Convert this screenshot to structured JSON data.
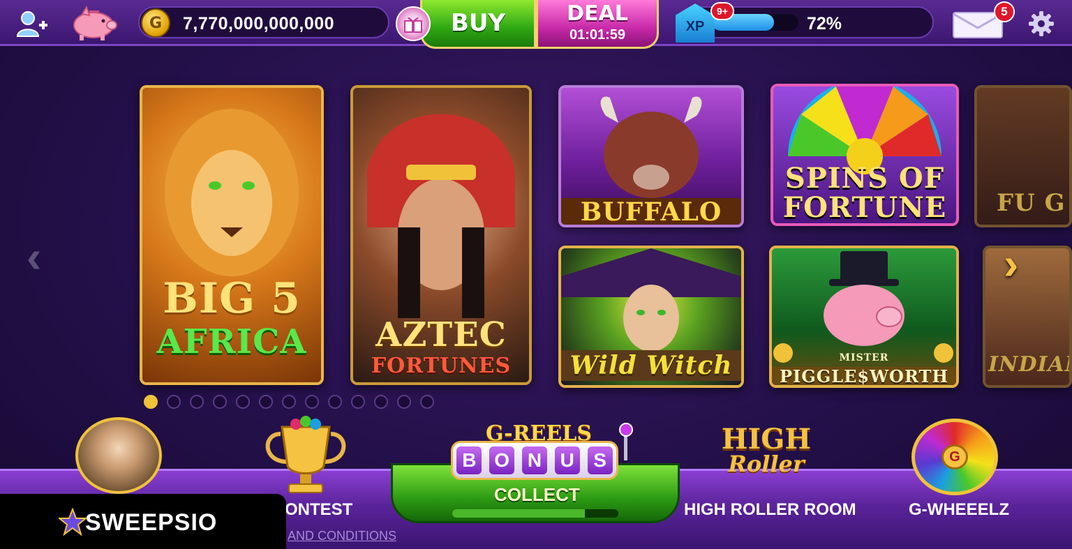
{
  "topbar": {
    "coins": "7,770,000,000,000",
    "coin_symbol": "G",
    "buy_label": "BUY",
    "deal_label": "DEAL",
    "deal_timer": "01:01:59",
    "xp_label": "XP",
    "xp_level_badge": "9+",
    "xp_percent_text": "72%",
    "xp_progress": 0.72,
    "mail_count": "5"
  },
  "carousel": {
    "games": [
      {
        "id": "big5",
        "line1": "BIG 5",
        "line2": "AFRICA"
      },
      {
        "id": "aztec",
        "line1": "AZTEC",
        "line2": "FORTUNES"
      },
      {
        "id": "buffalo",
        "line1": "BUFFALO"
      },
      {
        "id": "spins",
        "line1": "SPINS OF",
        "line2": "FORTUNE"
      },
      {
        "id": "fu",
        "line1": "FU G"
      },
      {
        "id": "witch",
        "line1": "Wild Witch"
      },
      {
        "id": "piggle",
        "line1": "MISTER",
        "line2": "PIGGLE$WORTH"
      },
      {
        "id": "indiana",
        "line1": "INDIANA"
      }
    ],
    "page_count": 13,
    "active_page": 1,
    "prev_glyph": "‹",
    "next_glyph": "›"
  },
  "bottombar": {
    "contest_label": "ONTEST",
    "greels_title": "G-REELS",
    "bonus_letters": [
      "B",
      "O",
      "N",
      "U",
      "S"
    ],
    "collect_label": "COLLECT",
    "collect_progress": 0.8,
    "highroller_logo_top": "HIGH",
    "highroller_logo_bottom": "Roller",
    "highroller_label": "HIGH ROLLER ROOM",
    "gwheel_center": "G",
    "gwheel_label": "G-WHEEELZ",
    "terms_link": "AND CONDITIONS"
  },
  "watermark": {
    "brand": "SWEEPSIO"
  },
  "icons": {
    "add_friend": "add-friend-icon",
    "piggy_bank": "piggy-bank-icon",
    "gift": "gift-icon",
    "mail": "mail-icon",
    "settings": "gear-icon",
    "trophy": "trophy-icon",
    "lever": "lever-icon",
    "star": "star-icon"
  },
  "colors": {
    "accent_gold": "#f0c23a",
    "buy_green": "#2ea814",
    "deal_pink": "#c72aa8",
    "badge_red": "#e0162b",
    "xp_blue": "#1e8fe6"
  }
}
